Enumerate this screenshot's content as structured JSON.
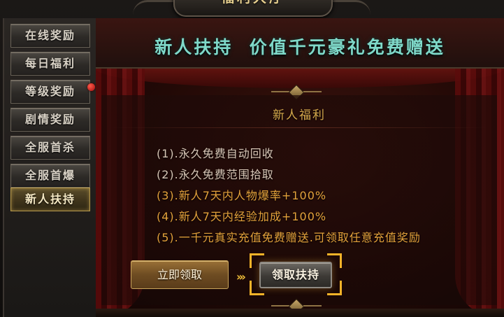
{
  "window": {
    "title": "福利大厅"
  },
  "sidebar": {
    "items": [
      {
        "label": "在线奖励",
        "active": false,
        "has_notice": false
      },
      {
        "label": "每日福利",
        "active": false,
        "has_notice": false
      },
      {
        "label": "等级奖励",
        "active": false,
        "has_notice": true
      },
      {
        "label": "剧情奖励",
        "active": false,
        "has_notice": false
      },
      {
        "label": "全服首杀",
        "active": false,
        "has_notice": false
      },
      {
        "label": "全服首爆",
        "active": false,
        "has_notice": false
      },
      {
        "label": "新人扶持",
        "active": true,
        "has_notice": false
      }
    ]
  },
  "main": {
    "banner": "新人扶持  价值千元豪礼免费赠送",
    "subtitle": "新人福利",
    "benefits": [
      "(1).永久免费自动回收",
      "(2).永久免费范围拾取",
      "(3).新人7天内人物爆率+100%",
      "(4).新人7天内经验加成+100%",
      "(5).一千元真实充值免费赠送.可领取任意充值奖励"
    ],
    "claim_now_label": "立即领取",
    "claim_support_label": "领取扶持"
  },
  "colors": {
    "banner_text": "#7fd9c9",
    "subtitle_text": "#d6a94c",
    "benefit_light": "#d7c6b6",
    "benefit_gold": "#e4a23b",
    "highlight_bracket": "#f3b329",
    "notice_dot": "#d01a14"
  },
  "icons": {
    "notice": "red-dot-icon",
    "arrow": "double-chevron-right-icon",
    "ornament": "diamond-ornament-icon"
  }
}
